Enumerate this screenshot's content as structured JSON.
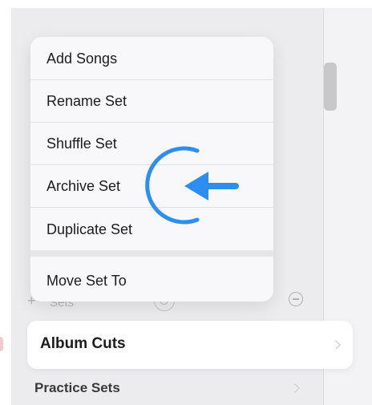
{
  "menu": {
    "items": [
      {
        "label": "Add Songs"
      },
      {
        "label": "Rename Set"
      },
      {
        "label": "Shuffle Set"
      },
      {
        "label": "Archive Set"
      },
      {
        "label": "Duplicate Set"
      },
      {
        "label": "Move Set To"
      }
    ]
  },
  "background": {
    "add_glyph": "+",
    "sets_label": "Sets"
  },
  "list": {
    "rows": [
      {
        "title": "Album Cuts"
      },
      {
        "title": "Practice Sets"
      }
    ]
  },
  "icons": {
    "pointer": "arrow-left-with-arc",
    "chevron": "chevron-right-icon",
    "remove": "minus-circle-icon",
    "center": "target-circle-icon"
  },
  "colors": {
    "accent": "#2b8ef0",
    "panel": "#ececee",
    "menu": "#f8f8fa",
    "text": "#1c1c1e"
  }
}
